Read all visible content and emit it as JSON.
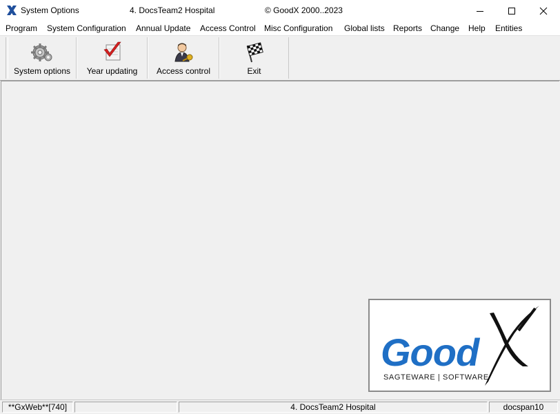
{
  "window": {
    "title": "System Options",
    "practice": "4. DocsTeam2 Hospital",
    "copyright": "© GoodX 2000..2023"
  },
  "menu": [
    "Program",
    "System Configuration",
    "Annual Update",
    "Access Control",
    "Misc Configuration",
    "Global lists",
    "Reports",
    "Change",
    "Help",
    "Entities"
  ],
  "toolbar": [
    {
      "label": "System options",
      "icon": "gears-icon"
    },
    {
      "label": "Year updating",
      "icon": "checkmark-calendar-icon"
    },
    {
      "label": "Access control",
      "icon": "user-key-icon"
    },
    {
      "label": "Exit",
      "icon": "checkered-flag-icon"
    }
  ],
  "logo": {
    "brand": "Good",
    "tagline": "SAGTEWARE | SOFTWARE",
    "colors": {
      "brand_blue": "#1f6fc5",
      "x_black": "#111111"
    }
  },
  "status": {
    "pane1": "**GxWeb**[740]",
    "pane2": "",
    "pane3": "4. DocsTeam2 Hospital",
    "pane4": "docspan10"
  }
}
